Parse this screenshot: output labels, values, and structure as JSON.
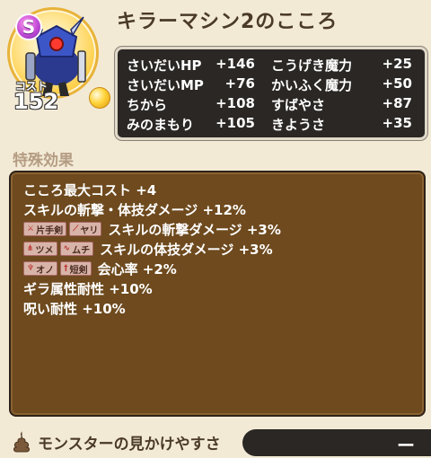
{
  "monster": {
    "rank": "S",
    "cost_label": "コスト",
    "cost_value": "152",
    "title": "キラーマシン2のこころ"
  },
  "stats": [
    [
      {
        "name": "さいだいHP",
        "value": "+146"
      },
      {
        "name": "こうげき魔力",
        "value": "+25"
      }
    ],
    [
      {
        "name": "さいだいMP",
        "value": "+76"
      },
      {
        "name": "かいふく魔力",
        "value": "+50"
      }
    ],
    [
      {
        "name": "ちから",
        "value": "+108"
      },
      {
        "name": "すばやさ",
        "value": "+87"
      }
    ],
    [
      {
        "name": "みのまもり",
        "value": "+105"
      },
      {
        "name": "きようさ",
        "value": "+35"
      }
    ]
  ],
  "effects": {
    "section_label": "特殊効果",
    "rows": [
      {
        "tags": [],
        "text": "こころ最大コスト +4"
      },
      {
        "tags": [],
        "text": "スキルの斬撃・体技ダメージ +12%"
      },
      {
        "tags": [
          {
            "icon": "sword-icon",
            "label": "片手剣"
          },
          {
            "icon": "spear-icon",
            "label": "ヤリ"
          }
        ],
        "text": "スキルの斬撃ダメージ +3%"
      },
      {
        "tags": [
          {
            "icon": "claw-icon",
            "label": "ツメ"
          },
          {
            "icon": "whip-icon",
            "label": "ムチ"
          }
        ],
        "text": "スキルの体技ダメージ +3%"
      },
      {
        "tags": [
          {
            "icon": "axe-icon",
            "label": "オノ"
          },
          {
            "icon": "dagger-icon",
            "label": "短剣"
          }
        ],
        "text": "会心率 +2%"
      },
      {
        "tags": [],
        "text": "ギラ属性耐性 +10%"
      },
      {
        "tags": [],
        "text": "呪い耐性 +10%"
      }
    ]
  },
  "footer": {
    "label": "モンスターの見かけやすさ",
    "value": "ー"
  }
}
